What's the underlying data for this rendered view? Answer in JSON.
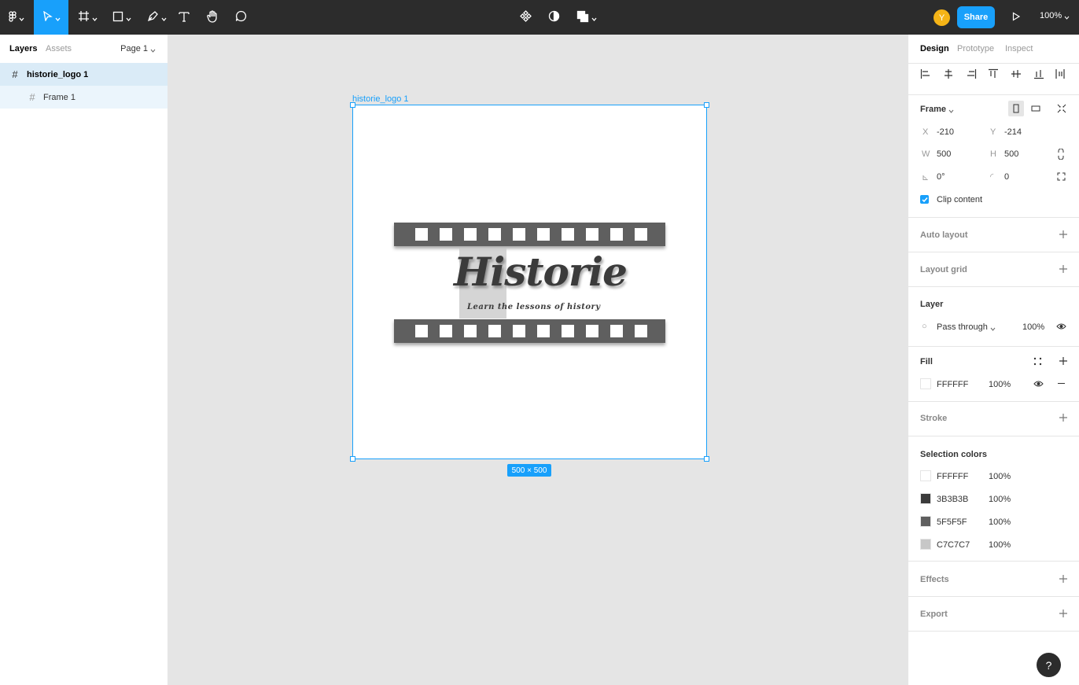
{
  "toolbar": {
    "zoom": "100%",
    "share_label": "Share",
    "avatar_initial": "Y",
    "tools": [
      "figma-menu-icon",
      "move-tool-icon",
      "frame-tool-icon",
      "rectangle-tool-icon",
      "pen-tool-icon",
      "text-tool-icon",
      "hand-tool-icon",
      "comment-tool-icon"
    ],
    "center_tools": [
      "components-icon",
      "mask-icon",
      "boolean-icon"
    ]
  },
  "left_panel": {
    "tabs": [
      "Layers",
      "Assets"
    ],
    "page": "Page 1",
    "layers": [
      {
        "name": "historie_logo 1",
        "selected": true
      },
      {
        "name": "Frame 1",
        "selected": false
      }
    ]
  },
  "canvas": {
    "frame_label": "historie_logo 1",
    "size_badge": "500 × 500",
    "logo_title": "Historie",
    "logo_tagline": "Learn the lessons of history"
  },
  "right_panel": {
    "tabs": [
      "Design",
      "Prototype",
      "Inspect"
    ],
    "frame_label": "Frame",
    "x_label": "X",
    "x": "-210",
    "y_label": "Y",
    "y": "-214",
    "w_label": "W",
    "w": "500",
    "h_label": "H",
    "h": "500",
    "rotation": "0°",
    "radius": "0",
    "clip_content": "Clip content",
    "auto_layout": "Auto layout",
    "layout_grid": "Layout grid",
    "layer_title": "Layer",
    "blend_mode": "Pass through",
    "layer_opacity": "100%",
    "fill_title": "Fill",
    "fill_hex": "FFFFFF",
    "fill_opacity": "100%",
    "stroke": "Stroke",
    "selection_colors_title": "Selection colors",
    "selection_colors": [
      {
        "hex": "FFFFFF",
        "opacity": "100%",
        "color": "#FFFFFF"
      },
      {
        "hex": "3B3B3B",
        "opacity": "100%",
        "color": "#3B3B3B"
      },
      {
        "hex": "5F5F5F",
        "opacity": "100%",
        "color": "#5F5F5F"
      },
      {
        "hex": "C7C7C7",
        "opacity": "100%",
        "color": "#C7C7C7"
      }
    ],
    "effects": "Effects",
    "export": "Export"
  },
  "help_label": "?",
  "colors": {
    "accent": "#18a0fb",
    "toolbar": "#2c2c2c",
    "canvas": "#e5e5e5"
  }
}
